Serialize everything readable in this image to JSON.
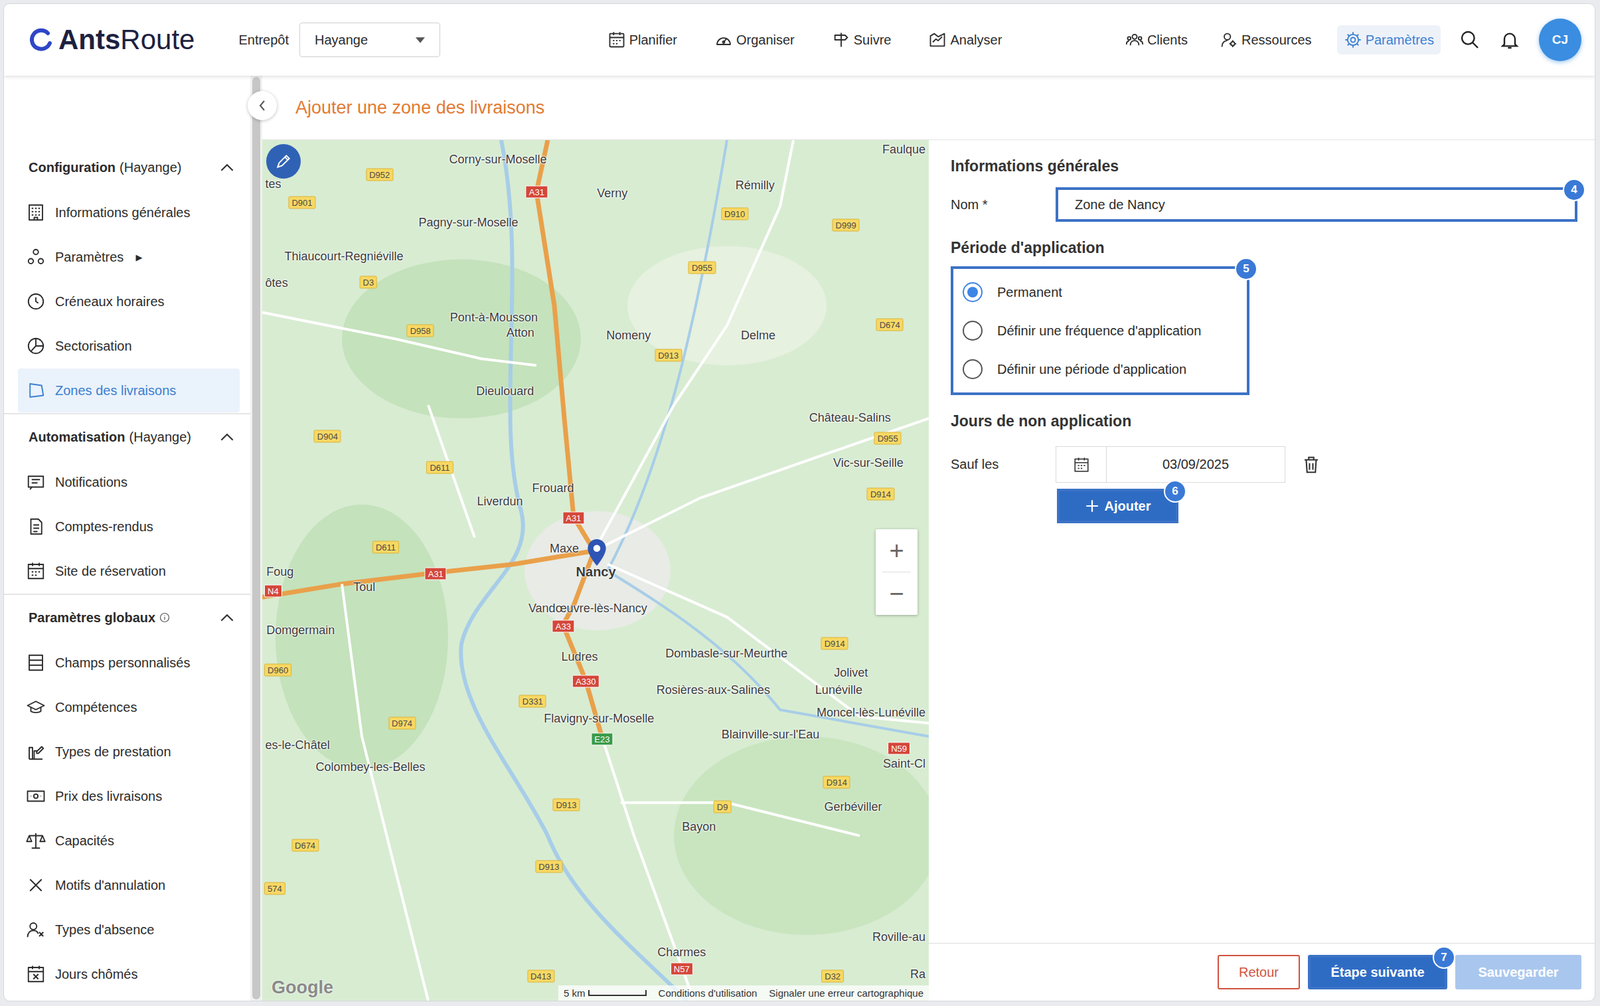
{
  "header": {
    "logo_bold": "Ants",
    "logo_light": "Route",
    "warehouse_label": "Entrepôt",
    "warehouse": "Hayange",
    "nav": [
      {
        "label": "Planifier",
        "selected": false
      },
      {
        "label": "Organiser",
        "selected": false
      },
      {
        "label": "Suivre",
        "selected": false
      },
      {
        "label": "Analyser",
        "selected": false
      }
    ],
    "right_nav": [
      {
        "label": "Clients",
        "selected": false
      },
      {
        "label": "Ressources",
        "selected": false
      },
      {
        "label": "Paramètres",
        "selected": true
      }
    ],
    "avatar": "CJ"
  },
  "sidebar": {
    "sections": [
      {
        "title": "Configuration",
        "suffix": "(Hayange)",
        "has_info": false,
        "expanded": true,
        "items": [
          {
            "label": "Informations générales",
            "selected": false
          },
          {
            "label": "Paramètres",
            "arrow": "▶",
            "selected": false
          },
          {
            "label": "Créneaux horaires",
            "selected": false
          },
          {
            "label": "Sectorisation",
            "selected": false
          },
          {
            "label": "Zones des livraisons",
            "selected": true
          }
        ]
      },
      {
        "title": "Automatisation",
        "suffix": "(Hayange)",
        "has_info": false,
        "expanded": true,
        "items": [
          {
            "label": "Notifications",
            "selected": false
          },
          {
            "label": "Comptes-rendus",
            "selected": false
          },
          {
            "label": "Site de réservation",
            "selected": false
          }
        ]
      },
      {
        "title": "Paramètres globaux",
        "suffix": "",
        "has_info": true,
        "expanded": true,
        "items": [
          {
            "label": "Champs personnalisés",
            "selected": false
          },
          {
            "label": "Compétences",
            "selected": false
          },
          {
            "label": "Types de prestation",
            "selected": false
          },
          {
            "label": "Prix des livraisons",
            "selected": false
          },
          {
            "label": "Capacités",
            "selected": false
          },
          {
            "label": "Motifs d'annulation",
            "selected": false
          },
          {
            "label": "Types d'absence",
            "selected": false
          },
          {
            "label": "Jours chômés",
            "selected": false
          }
        ]
      }
    ]
  },
  "page": {
    "title": "Ajouter une zone des livraisons"
  },
  "map": {
    "places": [
      "Faulque",
      "Corny-sur-Moselle",
      "Verny",
      "Rémilly",
      "tes",
      "Pagny-sur-Moselle",
      "Thiaucourt-Regniéville",
      "ôtes",
      "Pont-à-Mousson",
      "Atton",
      "Nomeny",
      "Delme",
      "Dieulouard",
      "Château-Salins",
      "Vic-sur-Seille",
      "Frouard",
      "Liverdun",
      "Maxe",
      "Nancy",
      "Foug",
      "Toul",
      "Vandœuvre-lès-Nancy",
      "Domgermain",
      "Ludres",
      "Dombasle-sur-Meurthe",
      "Jolivet",
      "Rosières-aux-Salines",
      "Lunéville",
      "Moncel-lès-Lunéville",
      "Flavigny-sur-Moselle",
      "Blainville-sur-l'Eau",
      "es-le-Châtel",
      "Colombey-les-Belles",
      "Saint-Cl",
      "Gerbéviller",
      "Bayon",
      "Roville-au",
      "Charmes",
      "Ra"
    ],
    "roads": [
      {
        "label": "D952",
        "kind": "d"
      },
      {
        "label": "A31",
        "kind": "a"
      },
      {
        "label": "D901",
        "kind": "d"
      },
      {
        "label": "D910",
        "kind": "d"
      },
      {
        "label": "D999",
        "kind": "d"
      },
      {
        "label": "D3",
        "kind": "d"
      },
      {
        "label": "D955",
        "kind": "d"
      },
      {
        "label": "D958",
        "kind": "d"
      },
      {
        "label": "D913",
        "kind": "d"
      },
      {
        "label": "D674",
        "kind": "d"
      },
      {
        "label": "D955",
        "kind": "d"
      },
      {
        "label": "D904",
        "kind": "d"
      },
      {
        "label": "D611",
        "kind": "d"
      },
      {
        "label": "D914",
        "kind": "d"
      },
      {
        "label": "A31",
        "kind": "a"
      },
      {
        "label": "D611",
        "kind": "d"
      },
      {
        "label": "A31",
        "kind": "a"
      },
      {
        "label": "N4",
        "kind": "n"
      },
      {
        "label": "A33",
        "kind": "a"
      },
      {
        "label": "D914",
        "kind": "d"
      },
      {
        "label": "D960",
        "kind": "d"
      },
      {
        "label": "A330",
        "kind": "a"
      },
      {
        "label": "D331",
        "kind": "d"
      },
      {
        "label": "D974",
        "kind": "d"
      },
      {
        "label": "E23",
        "kind": "e"
      },
      {
        "label": "N59",
        "kind": "n"
      },
      {
        "label": "D914",
        "kind": "d"
      },
      {
        "label": "D913",
        "kind": "d"
      },
      {
        "label": "D9",
        "kind": "d"
      },
      {
        "label": "D674",
        "kind": "d"
      },
      {
        "label": "D913",
        "kind": "d"
      },
      {
        "label": "574",
        "kind": "d"
      },
      {
        "label": "N57",
        "kind": "n"
      },
      {
        "label": "D413",
        "kind": "d"
      },
      {
        "label": "D32",
        "kind": "d"
      }
    ],
    "zoom_in": "+",
    "zoom_out": "−",
    "google": "Google",
    "scale": "5 km",
    "attribution": [
      "Conditions d'utilisation",
      "Signaler une erreur cartographique"
    ]
  },
  "form": {
    "general_heading": "Informations générales",
    "name_label": "Nom *",
    "name_value": "Zone de Nancy",
    "name_badge": "4",
    "period_heading": "Période d'application",
    "period_badge": "5",
    "period_options": [
      {
        "label": "Permanent",
        "selected": true
      },
      {
        "label": "Définir une fréquence d'application",
        "selected": false
      },
      {
        "label": "Définir une période d'application",
        "selected": false
      }
    ],
    "exceptions_heading": "Jours de non application",
    "except_label": "Sauf les",
    "dates": [
      "03/09/2025"
    ],
    "add_button": "Ajouter",
    "add_badge": "6"
  },
  "footer": {
    "buttons": [
      {
        "label": "Retour",
        "kind": "secondary",
        "disabled": false
      },
      {
        "label": "Étape suivante",
        "kind": "primary",
        "disabled": false,
        "badge": "7"
      },
      {
        "label": "Sauvegarder",
        "kind": "primary",
        "disabled": true
      }
    ]
  }
}
